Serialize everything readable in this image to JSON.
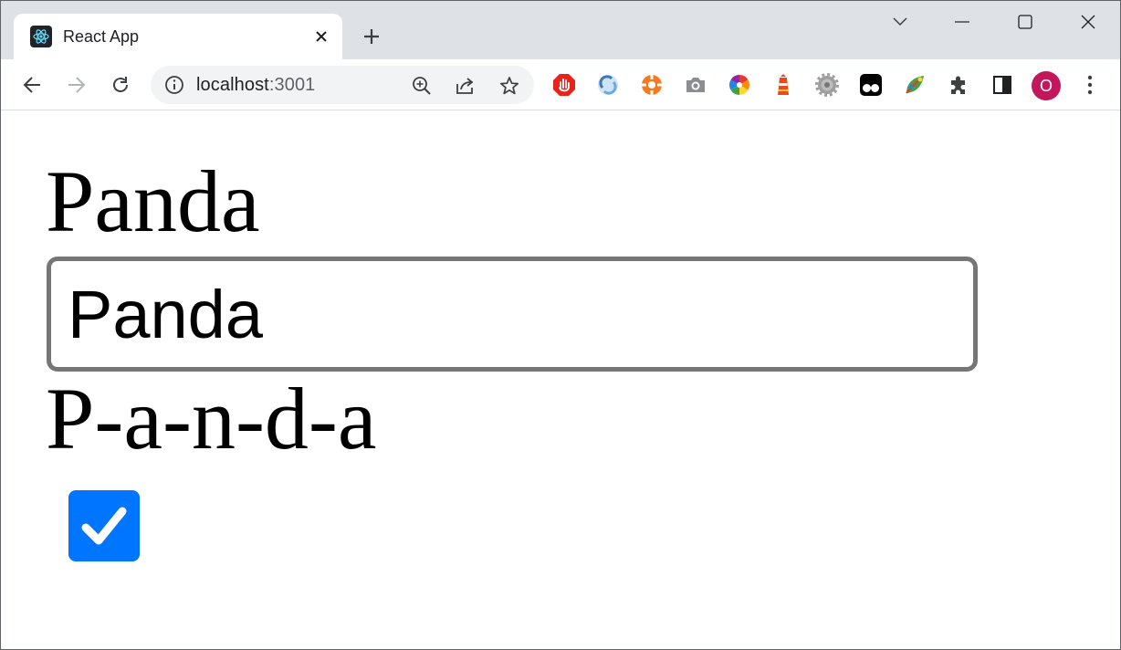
{
  "browser": {
    "tab": {
      "title": "React App",
      "favicon": "react-logo-icon"
    },
    "new_tab_icon": "plus-icon",
    "window_controls": [
      "tab-search-icon",
      "minimize-icon",
      "maximize-icon",
      "close-icon"
    ],
    "address_bar": {
      "host": "localhost",
      "port": ":3001",
      "site_info_icon": "info-icon",
      "actions": [
        "zoom-icon",
        "share-icon",
        "star-icon"
      ]
    },
    "extensions": [
      "adblock-icon",
      "sync-icon",
      "orange-circle-icon",
      "camera-icon",
      "color-wheel-icon",
      "lighthouse-icon",
      "gear-icon",
      "tampermonkey-icon",
      "colorful-leaf-icon",
      "puzzle-icon",
      "side-panel-icon"
    ],
    "profile_initial": "O",
    "profile_color": "#c2185b",
    "menu_icon": "kebab-menu-icon"
  },
  "page": {
    "heading": "Panda",
    "input_value": "Panda",
    "spelled": "P-a-n-d-a",
    "checkbox_checked": true,
    "checkbox_color": "#0075ff"
  }
}
